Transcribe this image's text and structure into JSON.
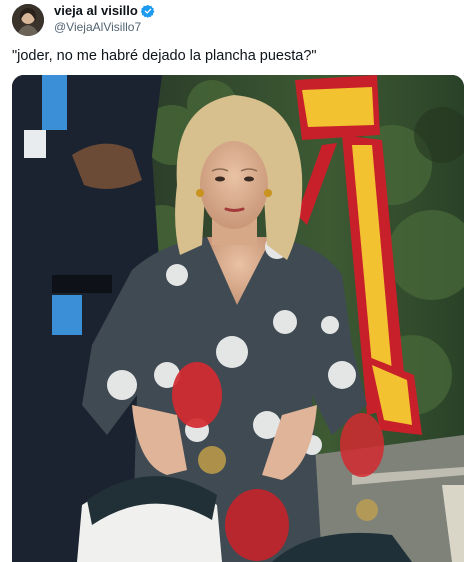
{
  "user": {
    "display_name": "vieja al visillo",
    "handle": "@ViejaAlVisillo7",
    "verified": true,
    "avatar_icon": "profile-photo-avatar"
  },
  "tweet": {
    "text": "\"joder, no me habré dejado la plancha puesta?\""
  },
  "media": {
    "description_icon": "photo",
    "colors": {
      "flag_red": "#c8202a",
      "flag_yellow": "#f2c230",
      "dress": "#3f4a52",
      "polka": "#e4e6e6",
      "foliage": "#2f4a2c",
      "verified_blue": "#1d9bf0"
    }
  }
}
